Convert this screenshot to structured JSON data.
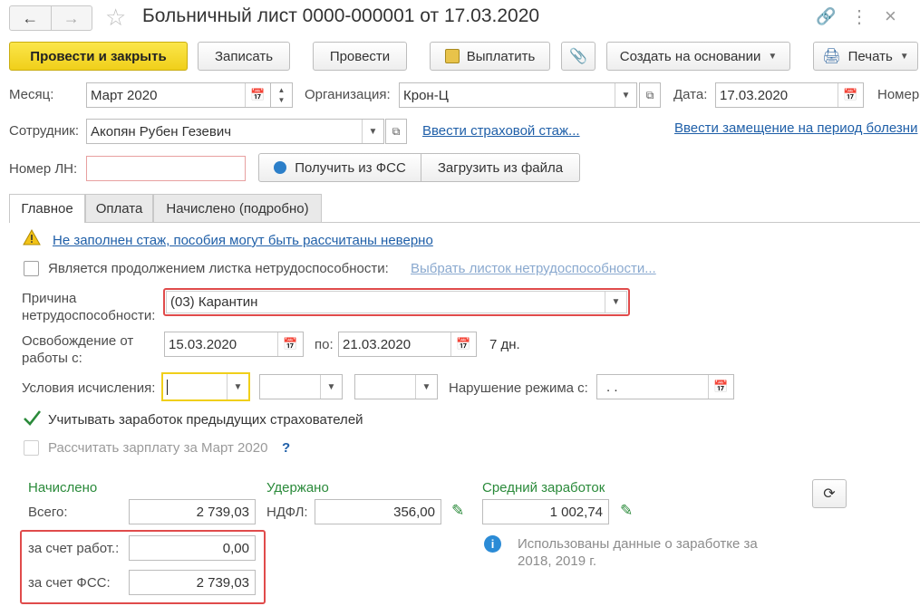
{
  "window": {
    "title": "Больничный лист 0000-000001 от 17.03.2020"
  },
  "toolbar": {
    "post_close": "Провести и закрыть",
    "save": "Записать",
    "post": "Провести",
    "pay": "Выплатить",
    "create_based": "Создать на основании",
    "print": "Печать"
  },
  "header": {
    "month_label": "Месяц:",
    "month_value": "Март 2020",
    "org_label": "Организация:",
    "org_value": "Крон-Ц",
    "date_label": "Дата:",
    "date_value": "17.03.2020",
    "number_label": "Номер",
    "employee_label": "Сотрудник:",
    "employee_value": "Акопян Рубен Гезевич",
    "insurance_link": "Ввести страховой стаж...",
    "replacement_link": "Ввести замещение на период болезни",
    "ln_label": "Номер ЛН:",
    "ln_value": "",
    "get_fss": "Получить из ФСС",
    "load_file": "Загрузить из файла"
  },
  "tabs": [
    {
      "label": "Главное"
    },
    {
      "label": "Оплата"
    },
    {
      "label": "Начислено (подробно)"
    }
  ],
  "main": {
    "warning": "Не заполнен стаж, пособия могут быть рассчитаны неверно",
    "continuation_label": "Является продолжением листка нетрудоспособности:",
    "continuation_link": "Выбрать листок нетрудоспособности...",
    "reason_label_1": "Причина",
    "reason_label_2": "нетрудоспособности:",
    "reason_value": "(03) Карантин",
    "release_label_1": "Освобождение от",
    "release_label_2": "работы с:",
    "release_from": "15.03.2020",
    "to_label": "по:",
    "release_to": "21.03.2020",
    "days": "7 дн.",
    "conditions_label": "Условия исчисления:",
    "violation_label": "Нарушение режима с:",
    "violation_value": " .  .",
    "prev_earnings_label": "Учитывать заработок предыдущих страхователей",
    "calc_salary_label": "Рассчитать зарплату за Март 2020",
    "help": "?"
  },
  "totals": {
    "accrued_title": "Начислено",
    "withheld_title": "Удержано",
    "avg_title": "Средний заработок",
    "total_label": "Всего:",
    "total_value": "2 739,03",
    "ndfl_label": "НДФЛ:",
    "ndfl_value": "356,00",
    "avg_value": "1 002,74",
    "employer_label": "за счет работ.:",
    "employer_value": "0,00",
    "fss_label": "за счет ФСС:",
    "fss_value": "2 739,03",
    "info_text_1": "Использованы данные о заработке за",
    "info_text_2": "2018,  2019 г."
  },
  "colors": {
    "accent_yellow": "#f0cf1a",
    "link": "#1f5fa8",
    "green": "#2a8a3a",
    "highlight": "#e04b4b"
  }
}
